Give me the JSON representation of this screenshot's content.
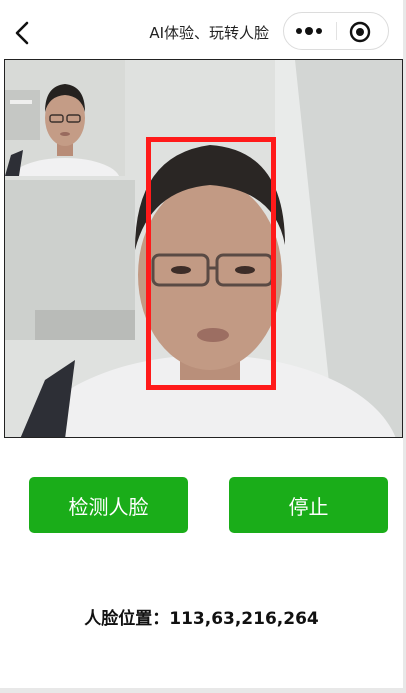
{
  "navbar": {
    "title": "AI体验、玩转人脸",
    "back_icon": "chevron-left-icon",
    "more_icon": "more-dots-icon",
    "close_icon": "target-circle-icon"
  },
  "camera": {
    "preview_alt": "camera preview",
    "face_box_color": "#ff1a1a"
  },
  "buttons": {
    "detect_label": "检测人脸",
    "stop_label": "停止",
    "color": "#1aad19"
  },
  "result": {
    "label": "人脸位置：",
    "value": "113,63,216,264"
  }
}
